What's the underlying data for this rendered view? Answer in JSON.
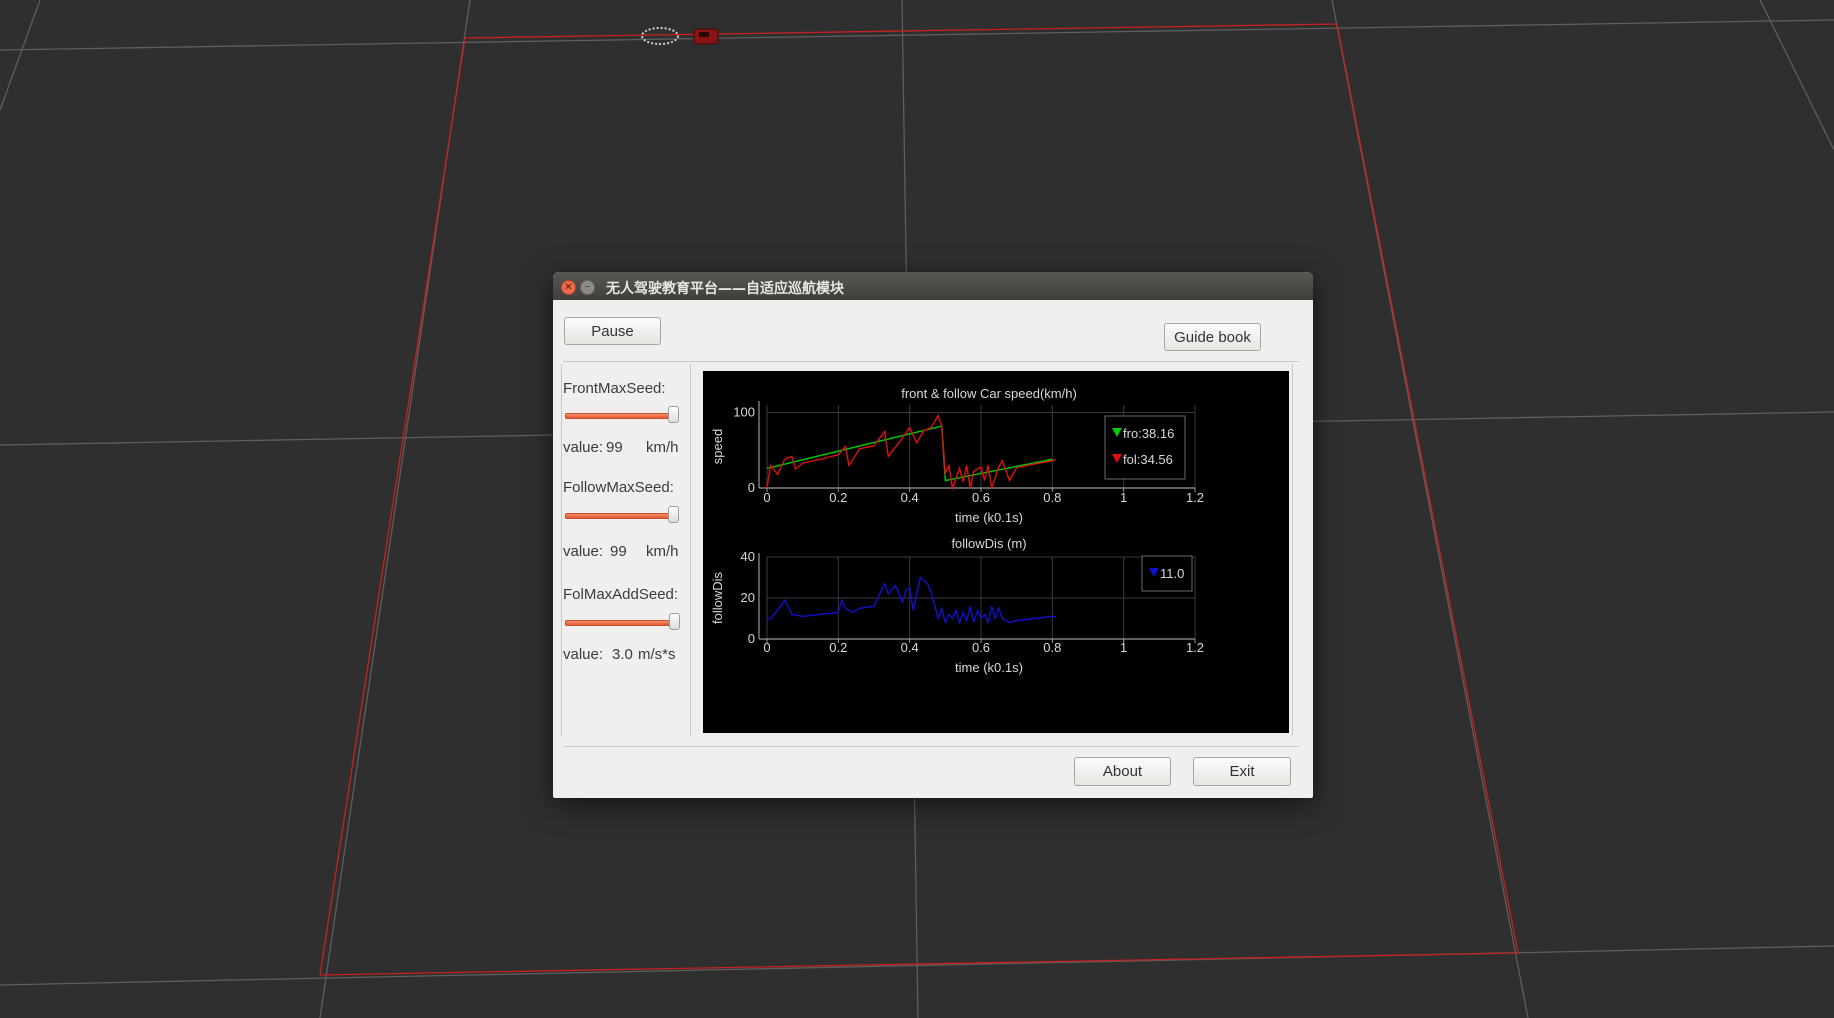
{
  "window": {
    "title": "无人驾驶教育平台——自适应巡航模块"
  },
  "toolbar": {
    "pause_label": "Pause",
    "guide_label": "Guide book"
  },
  "controls": {
    "front": {
      "label": "FrontMaxSeed:",
      "slider_fraction": 0.99,
      "value_prefix": "value:",
      "value": "99",
      "unit": "km/h"
    },
    "follow": {
      "label": "FollowMaxSeed:",
      "slider_fraction": 0.99,
      "value_prefix": "value:",
      "value": "99",
      "unit": "km/h"
    },
    "foladd": {
      "label": "FolMaxAddSeed:",
      "slider_fraction": 1.0,
      "value_prefix": "value:",
      "value": "3.0",
      "unit": "m/s*s"
    }
  },
  "footer": {
    "about_label": "About",
    "exit_label": "Exit"
  },
  "colors": {
    "front_series": "#00cc00",
    "follow_series": "#e01010",
    "dist_series": "#1010d0",
    "slider_accent": "#e4572e",
    "background": "#2f2f2f"
  },
  "chart_data": [
    {
      "type": "line",
      "title": "front & follow Car speed(km/h)",
      "xlabel": "time (k0.1s)",
      "ylabel": "speed",
      "xlim": [
        0,
        1.2
      ],
      "ylim": [
        0,
        110
      ],
      "xticks": [
        "0",
        "0.2",
        "0.4",
        "0.6",
        "0.8",
        "1",
        "1.2"
      ],
      "yticks": [
        "0",
        "100"
      ],
      "grid": true,
      "legend_position": "top-right",
      "legend": [
        {
          "marker": "green-triangle",
          "text": "fro:38.16"
        },
        {
          "marker": "red-triangle",
          "text": "fol:34.56"
        }
      ],
      "series": [
        {
          "color": "green",
          "x": [
            0,
            0.49,
            0.49,
            0.5,
            0.8
          ],
          "y": [
            26,
            82,
            82,
            10,
            38
          ]
        },
        {
          "color": "red",
          "x": [
            0,
            0.01,
            0.03,
            0.05,
            0.07,
            0.08,
            0.1,
            0.15,
            0.2,
            0.22,
            0.23,
            0.26,
            0.3,
            0.33,
            0.34,
            0.37,
            0.4,
            0.42,
            0.44,
            0.46,
            0.48,
            0.49,
            0.5,
            0.51,
            0.52,
            0.54,
            0.55,
            0.56,
            0.57,
            0.58,
            0.6,
            0.61,
            0.62,
            0.63,
            0.65,
            0.66,
            0.68,
            0.7,
            0.75,
            0.8,
            0.81
          ],
          "y": [
            0,
            30,
            18,
            38,
            42,
            25,
            33,
            38,
            44,
            55,
            30,
            52,
            56,
            75,
            42,
            60,
            80,
            60,
            76,
            80,
            96,
            82,
            20,
            30,
            0,
            26,
            8,
            30,
            0,
            22,
            28,
            10,
            30,
            0,
            28,
            36,
            10,
            27,
            32,
            36,
            38
          ]
        }
      ]
    },
    {
      "type": "line",
      "title": "followDis (m)",
      "xlabel": "time (k0.1s)",
      "ylabel": "followDis",
      "xlim": [
        0,
        1.2
      ],
      "ylim": [
        0,
        40
      ],
      "xticks": [
        "0",
        "0.2",
        "0.4",
        "0.6",
        "0.8",
        "1",
        "1.2"
      ],
      "yticks": [
        "0",
        "20",
        "40"
      ],
      "grid": true,
      "legend_position": "top-right",
      "legend": [
        {
          "marker": "blue-triangle",
          "text": "11.0"
        }
      ],
      "series": [
        {
          "color": "blue",
          "x": [
            0,
            0.01,
            0.03,
            0.05,
            0.07,
            0.1,
            0.15,
            0.2,
            0.21,
            0.22,
            0.24,
            0.26,
            0.3,
            0.33,
            0.34,
            0.36,
            0.38,
            0.39,
            0.4,
            0.41,
            0.43,
            0.45,
            0.46,
            0.48,
            0.49,
            0.5,
            0.51,
            0.52,
            0.53,
            0.54,
            0.55,
            0.56,
            0.57,
            0.58,
            0.59,
            0.6,
            0.61,
            0.62,
            0.63,
            0.64,
            0.65,
            0.66,
            0.68,
            0.7,
            0.75,
            0.8,
            0.81
          ],
          "y": [
            9,
            10,
            14,
            19,
            12,
            11,
            12,
            13,
            19,
            15,
            13,
            15,
            16,
            27,
            22,
            26,
            18,
            24,
            25,
            14,
            30,
            27,
            23,
            10,
            15,
            8,
            12,
            10,
            14,
            8,
            13,
            9,
            16,
            8,
            14,
            10,
            12,
            8,
            16,
            10,
            15,
            10,
            8,
            9,
            10,
            11,
            11
          ]
        }
      ]
    }
  ]
}
